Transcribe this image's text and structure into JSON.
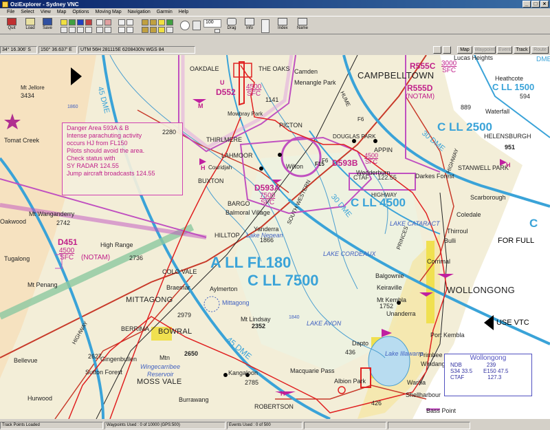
{
  "window": {
    "title": "OziExplorer - Sydney VNC"
  },
  "menu": [
    "File",
    "Select",
    "View",
    "Map",
    "Options",
    "Moving Map",
    "Navigation",
    "Garmin",
    "Help"
  ],
  "toolbar": {
    "buttons": [
      {
        "label": "Quit"
      },
      {
        "label": "Load"
      },
      {
        "label": "Save"
      },
      {
        "label": "Drag"
      },
      {
        "label": "Info"
      },
      {
        "label": "Index"
      },
      {
        "label": "Name"
      }
    ],
    "zoom": "100"
  },
  "coords": {
    "lat": "34° 16.306' S",
    "lon": "150° 36.637' E",
    "utm": "UTM  56H   281115E    6208430N   WGS 84"
  },
  "view_tabs": [
    "Map",
    "Waypoint",
    "Event",
    "Track",
    "Route"
  ],
  "map": {
    "towns": [
      "OAKDALE",
      "THE OAKS",
      "CAMPBELLTOWN",
      "Camden",
      "Menangle Park",
      "PICTON",
      "THIRLMERE",
      "LAHMOOR",
      "Couridjah",
      "Wilton",
      "DOUGLAS PARK",
      "APPIN",
      "BUXTON",
      "BARGO",
      "Balmoral Village",
      "HILLTOP",
      "Yanderra",
      "COLO VALE",
      "Braemar",
      "Aylmerton",
      "MITTAGONG",
      "Mittagong",
      "BERRIMA",
      "BOWRAL",
      "MOSS VALE",
      "Sutton Forest",
      "Kangaloon",
      "Macquarie Pass",
      "Burrawang",
      "ROBERTSON",
      "Dapto",
      "Albion Park",
      "Wedderburn",
      "STANWELL PARK",
      "Darkes Forest",
      "HELENSBURGH",
      "Heathcote",
      "Waterfall",
      "Scarborough",
      "Coledale",
      "Thirroul",
      "Bulli",
      "Corrimal",
      "WOLLONGONG",
      "Port Kembla",
      "Primbee",
      "Windang",
      "Warilla",
      "Shellharbour",
      "Bass Point",
      "Balgownie",
      "Keiraville",
      "Mt Kembla",
      "Unanderra",
      "Mt Wanganderry",
      "High Range",
      "Tugalong",
      "Mt Penang",
      "Mt Lindsay",
      "Mowbray Park",
      "Mt Jellore",
      "Tomat Creek",
      "Oakwood",
      "Bellevue",
      "Hurwood",
      "Gingenbullen",
      "Mtn",
      "Wingecarribee",
      "Reservoir",
      "Lucas Heights",
      "LAKE CATARACT",
      "LAKE CORDEAUX",
      "LAKE AVON",
      "Lake Illawarra",
      "Lake Nepean"
    ],
    "elevations": [
      "2280",
      "3434",
      "2742",
      "2736",
      "2979",
      "2650",
      "2627",
      "2352",
      "1866",
      "1860",
      "1752",
      "2785",
      "889",
      "951",
      "594",
      "1141",
      "1840",
      "436",
      "426"
    ],
    "airspace": [
      {
        "name": "D552",
        "top": "4500",
        "bottom": "SFC"
      },
      {
        "name": "D593A",
        "top": "7500",
        "bottom": "SFC"
      },
      {
        "name": "D593B",
        "top": "4500",
        "bottom": "SFC"
      },
      {
        "name": "D451",
        "top": "4500",
        "bottom": "SFC",
        "note": "(NOTAM)"
      },
      {
        "name": "R555C",
        "top": "3000",
        "bottom": "SFC"
      },
      {
        "name": "R555D",
        "note": "(NOTAM)"
      }
    ],
    "class_labels": [
      "A  LL  FL180",
      "C  LL  7500",
      "C  LL  4500",
      "C  LL  2500",
      "C  LL  1500",
      "C"
    ],
    "dme_labels": [
      "45 DME",
      "30 DME",
      "45 DME",
      "30 DME",
      "DME"
    ],
    "roads": [
      "HUME",
      "SOUTH WESTERN",
      "HIGHWAY",
      "PRINCES",
      "HIGHWAY",
      "F6",
      "F6",
      "HIGHWAY"
    ],
    "for_full": "FOR FULL",
    "vtc": "USE VTC",
    "danger_box": {
      "lines": [
        "Danger Area 593A & B",
        "Intense parachuting activity",
        "occurs HJ from FL150",
        "Pilots should avoid the area.",
        "Check status with",
        "SY RADAR 124.55",
        "Jump aircraft broadcasts 124.55"
      ]
    },
    "wedderburn": {
      "name": "Wedderburn",
      "ctaf": "CTAF",
      "freq": "122.55"
    },
    "ndb_box": {
      "title": "Wollongong",
      "ndb_label": "NDB",
      "ndb_freq": "239",
      "lat": "S34  33.5",
      "lon": "E150  47.5",
      "ctaf": "CTAF",
      "ctaf_freq": "127.3"
    },
    "codes": [
      "F15",
      "H",
      "H",
      "H",
      "U",
      "M"
    ]
  },
  "status": {
    "left": "Track Points Loaded",
    "waypoints": "Waypoints Used : 0 of 10000  (GPS:500)",
    "events": "Events Used : 0 of 500"
  }
}
